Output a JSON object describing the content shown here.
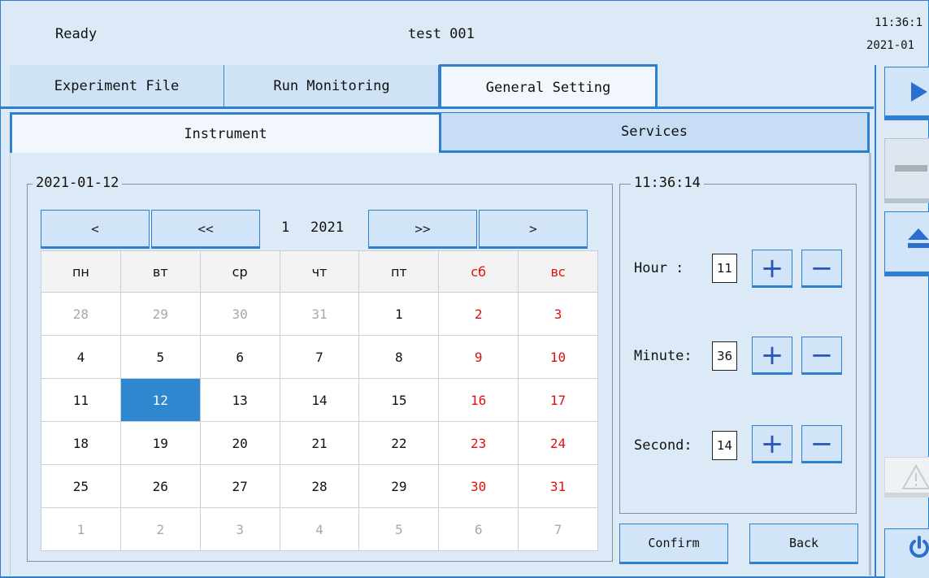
{
  "status": {
    "text": "Ready"
  },
  "header": {
    "title": "test 001",
    "clock_time": "11:36:1",
    "clock_date": "2021-01"
  },
  "main_tabs": [
    {
      "label": "Experiment File"
    },
    {
      "label": "Run Monitoring"
    },
    {
      "label": "General Setting"
    }
  ],
  "sub_tabs": [
    {
      "label": "Instrument"
    },
    {
      "label": "Services"
    }
  ],
  "calendar": {
    "date_legend": "2021-01-12",
    "nav": {
      "prev": "<",
      "prev_year": "<<",
      "next_year": ">>",
      "next": ">"
    },
    "month": "1",
    "year": "2021",
    "weekdays": [
      "пн",
      "вт",
      "ср",
      "чт",
      "пт",
      "сб",
      "вс"
    ],
    "rows": [
      [
        "28",
        "29",
        "30",
        "31",
        "1",
        "2",
        "3"
      ],
      [
        "4",
        "5",
        "6",
        "7",
        "8",
        "9",
        "10"
      ],
      [
        "11",
        "12",
        "13",
        "14",
        "15",
        "16",
        "17"
      ],
      [
        "18",
        "19",
        "20",
        "21",
        "22",
        "23",
        "24"
      ],
      [
        "25",
        "26",
        "27",
        "28",
        "29",
        "30",
        "31"
      ],
      [
        "1",
        "2",
        "3",
        "4",
        "5",
        "6",
        "7"
      ]
    ],
    "selected_day": "12"
  },
  "time": {
    "legend": "11:36:14",
    "hour_label": "Hour  :",
    "hour_value": "11",
    "minute_label": "Minute:",
    "minute_value": "36",
    "second_label": "Second:",
    "second_value": "14",
    "plus": "+",
    "minus": "−"
  },
  "actions": {
    "confirm": "Confirm",
    "back": "Back"
  },
  "colors": {
    "accent": "#2f7fd0",
    "weekend": "#e01010",
    "selected": "#2e87cf",
    "background": "#dce9f7"
  },
  "icons": [
    "play-icon",
    "stop-icon",
    "eject-icon",
    "warning-icon",
    "power-icon"
  ]
}
